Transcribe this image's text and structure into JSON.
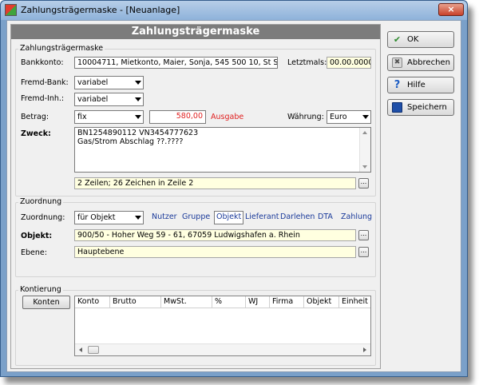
{
  "window": {
    "title": "Zahlungsträgermaske - [Neuanlage]",
    "close_symbol": "×"
  },
  "banner": "Zahlungsträgermaske",
  "group1": {
    "label": "Zahlungsträgermaske"
  },
  "bankkonto": {
    "label": "Bankkonto:",
    "value": "10004711, Mietkonto, Maier, Sonja, 545 500 10, St Spk L"
  },
  "letztmals": {
    "label": "Letztmals:",
    "value": "00.00.0000"
  },
  "fremd_bank": {
    "label": "Fremd-Bank:",
    "value": "variabel"
  },
  "fremd_inh": {
    "label": "Fremd-Inh.:",
    "value": "variabel"
  },
  "betrag": {
    "label": "Betrag:",
    "mode": "fix",
    "value": "580,00",
    "type": "Ausgabe"
  },
  "waehrung": {
    "label": "Währung:",
    "value": "Euro"
  },
  "zweck": {
    "label": "Zweck:",
    "line1": "BN1254890112 VN3454777623",
    "line2": "Gas/Strom Abschlag ??.????",
    "info": "2 Zeilen; 26 Zeichen in Zeile 2"
  },
  "ellipsis": "...",
  "group2": {
    "label": "Zuordnung"
  },
  "zuordnung": {
    "label": "Zuordnung:",
    "value": "für Objekt"
  },
  "tabs": [
    {
      "label": "Nutzer"
    },
    {
      "label": "Gruppe"
    },
    {
      "label": "Objekt"
    },
    {
      "label": "Lieferant"
    },
    {
      "label": "Darlehen"
    },
    {
      "label": "DTA"
    },
    {
      "label": "Zahlung"
    }
  ],
  "objekt": {
    "label": "Objekt:",
    "value": "900/50 - Hoher Weg 59 - 61, 67059 Ludwigshafen a. Rhein"
  },
  "ebene": {
    "label": "Ebene:",
    "value": "Hauptebene"
  },
  "group3": {
    "label": "Kontierung"
  },
  "konten_button": "Konten",
  "table_headers": [
    "Konto",
    "Brutto",
    "MwSt.",
    "%",
    "WJ",
    "Firma",
    "Objekt",
    "Einheit"
  ],
  "side_buttons": {
    "ok": "OK",
    "abbrechen": "Abbrechen",
    "hilfe": "Hilfe",
    "speichern": "Speichern"
  },
  "colors": {
    "banner": "#7c7c7c",
    "field_yellow": "#ffffe0",
    "ausgabe_red": "#e02020",
    "tab_blue": "#1a3a9a"
  }
}
